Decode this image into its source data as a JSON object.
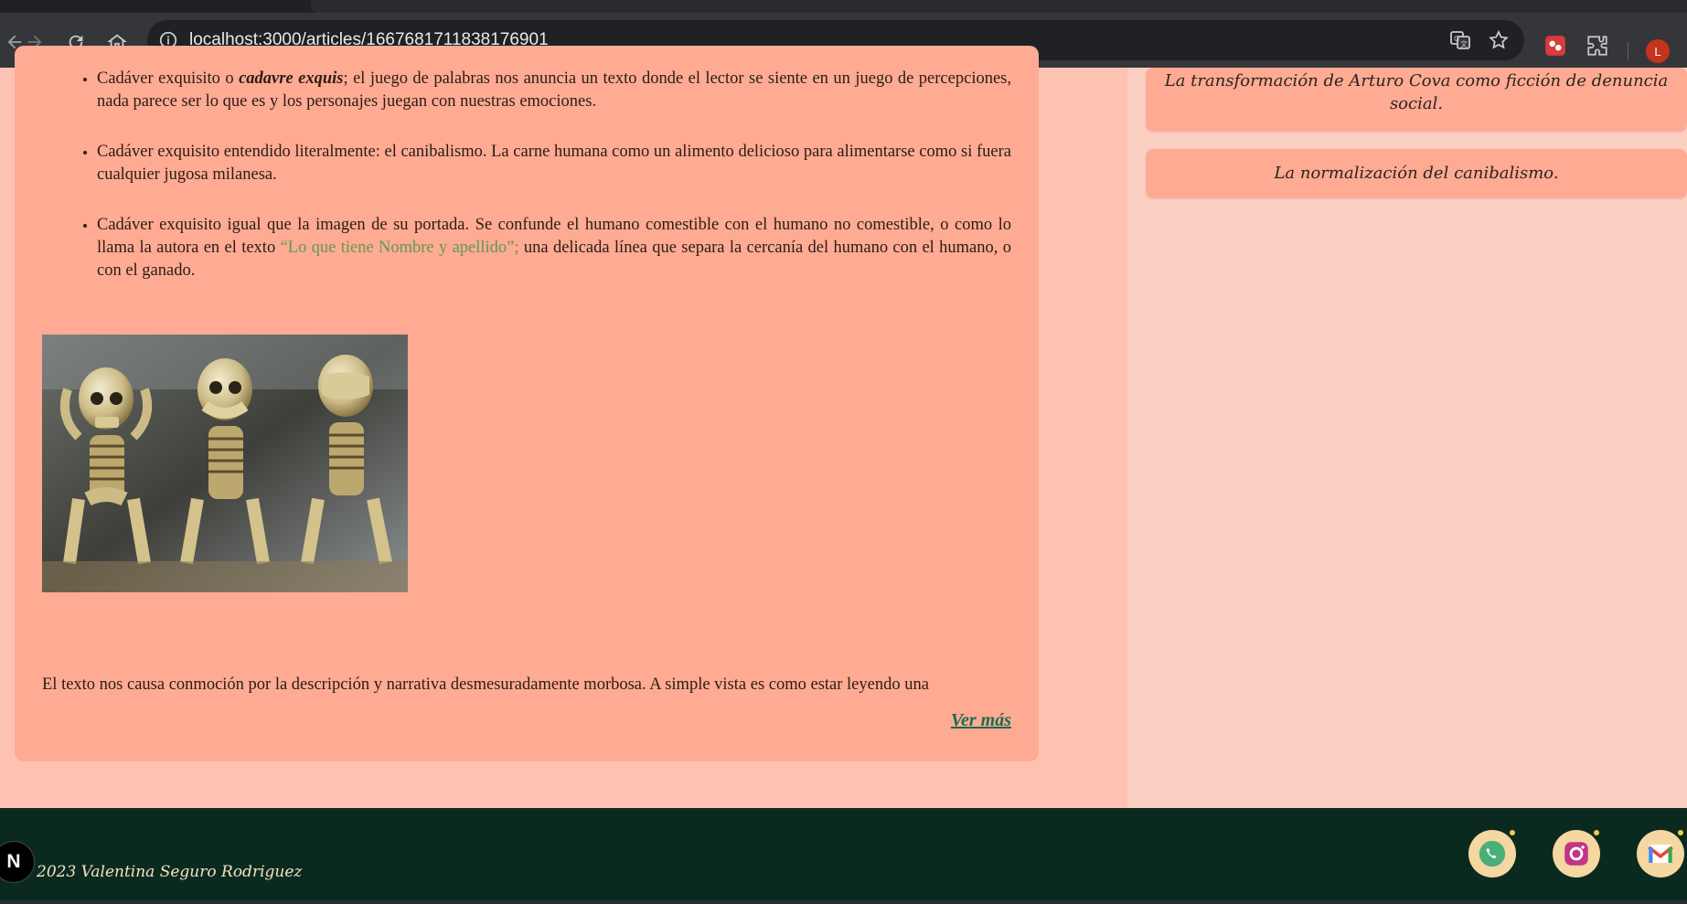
{
  "browser": {
    "url": "localhost:3000/articles/1667681711838176901",
    "profile_initial": "L"
  },
  "article": {
    "bullets": [
      {
        "before": "Cadáver exquisito o ",
        "emphasis": "cadavre exquis",
        "after": "; el juego de palabras nos anuncia un texto donde el lector se siente en un juego de percepciones, nada parece ser lo que es y los personajes juegan con nuestras emociones."
      },
      {
        "text": "Cadáver exquisito entendido literalmente: el canibalismo. La carne humana como un alimento delicioso para alimentarse como si fuera cualquier jugosa milanesa."
      },
      {
        "before": "Cadáver exquisito igual que la imagen de su portada. Se confunde el humano comestible con el humano no comestible, o como lo llama la autora en el texto ",
        "highlight": "“Lo que tiene Nombre y apellido”;",
        "after": " una delicada línea que separa la cercanía del humano con el humano, o con el ganado."
      }
    ],
    "closing_text": "El texto nos causa conmoción por la descripción y narrativa desmesuradamente morbosa. A simple vista es como estar leyendo una",
    "read_more": "Ver más"
  },
  "related": [
    "La transformación de Arturo Cova como ficción de denuncia social.",
    "La normalización del canibalismo."
  ],
  "footer": {
    "credit": "2023 Valentina Seguro Rodriguez",
    "next_badge": "N"
  },
  "icons": [
    "back-arrow-icon",
    "forward-arrow-icon",
    "reload-icon",
    "home-icon",
    "site-info-icon",
    "translate-icon",
    "star-icon",
    "extension-icon",
    "puzzle-icon",
    "whatsapp-icon",
    "instagram-icon",
    "gmail-icon"
  ],
  "colors": {
    "page_bg": "#fdc2b2",
    "card_bg": "#ffab94",
    "sidebar_bg": "#fbcfc1",
    "footer_bg": "#0b2a1f",
    "link": "#5f9a52",
    "read_more": "#1e6b4f"
  }
}
